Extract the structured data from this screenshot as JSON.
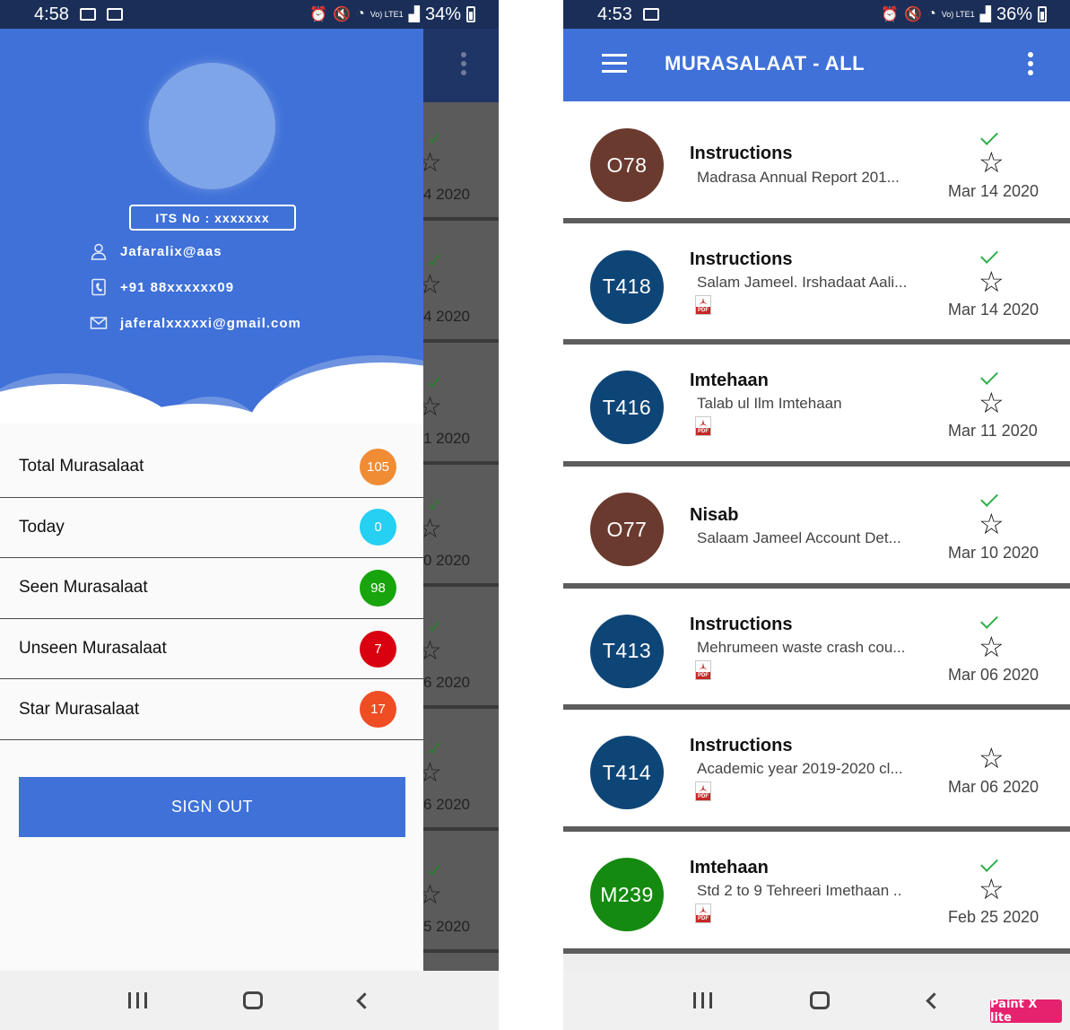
{
  "left_screen": {
    "status": {
      "time": "4:58",
      "battery": "34%",
      "network": "Vo) LTE1"
    },
    "profile": {
      "its_no": "ITS No : xxxxxxx",
      "username": "Jafaralix@aas",
      "phone": "+91 88xxxxxx09",
      "email": "jaferalxxxxxi@gmail.com"
    },
    "menu": [
      {
        "label": "Total Murasalaat",
        "count": "105",
        "color": "#ef8c34"
      },
      {
        "label": "Today",
        "count": "0",
        "color": "#25d0f2"
      },
      {
        "label": "Seen Murasalaat",
        "count": "98",
        "color": "#17a40c"
      },
      {
        "label": "Unseen Murasalaat",
        "count": "7",
        "color": "#d9000f"
      },
      {
        "label": "Star Murasalaat",
        "count": "17",
        "color": "#ef4d24"
      }
    ],
    "sign_out": "SIGN OUT",
    "background_dates": [
      "4 2020",
      "4 2020",
      "1 2020",
      "0 2020",
      "6 2020",
      "6 2020",
      "5 2020"
    ]
  },
  "right_screen": {
    "status": {
      "time": "4:53",
      "battery": "36%",
      "network": "Vo) LTE1"
    },
    "title": "MURASALAAT - ALL",
    "items": [
      {
        "code": "O78",
        "color": "#6b3a2e",
        "subject": "Instructions",
        "preview": "Madrasa Annual Report 201...",
        "pdf": false,
        "seen": true,
        "date": "Mar 14 2020"
      },
      {
        "code": "T418",
        "color": "#0e4577",
        "subject": "Instructions",
        "preview": "Salam Jameel. Irshadaat Aali...",
        "pdf": true,
        "seen": true,
        "date": "Mar 14 2020"
      },
      {
        "code": "T416",
        "color": "#0e4577",
        "subject": "Imtehaan",
        "preview": "Talab ul Ilm Imtehaan",
        "pdf": true,
        "seen": true,
        "date": "Mar 11 2020"
      },
      {
        "code": "O77",
        "color": "#6b3a2e",
        "subject": "Nisab",
        "preview": "Salaam Jameel Account Det...",
        "pdf": false,
        "seen": true,
        "date": "Mar 10 2020"
      },
      {
        "code": "T413",
        "color": "#0e4577",
        "subject": "Instructions",
        "preview": "Mehrumeen waste crash cou...",
        "pdf": true,
        "seen": true,
        "date": "Mar 06 2020"
      },
      {
        "code": "T414",
        "color": "#0e4577",
        "subject": "Instructions",
        "preview": "Academic year 2019-2020 cl...",
        "pdf": true,
        "seen": false,
        "date": "Mar 06 2020"
      },
      {
        "code": "M239",
        "color": "#148a10",
        "subject": "Imtehaan",
        "preview": "Std 2 to 9 Tehreeri Imethaan ..",
        "pdf": true,
        "seen": true,
        "date": "Feb 25 2020"
      }
    ]
  },
  "watermark": "Paint X lite",
  "colors": {
    "primary": "#3f71d8",
    "statusbar": "#1a2e57",
    "check": "#2eae4a"
  }
}
